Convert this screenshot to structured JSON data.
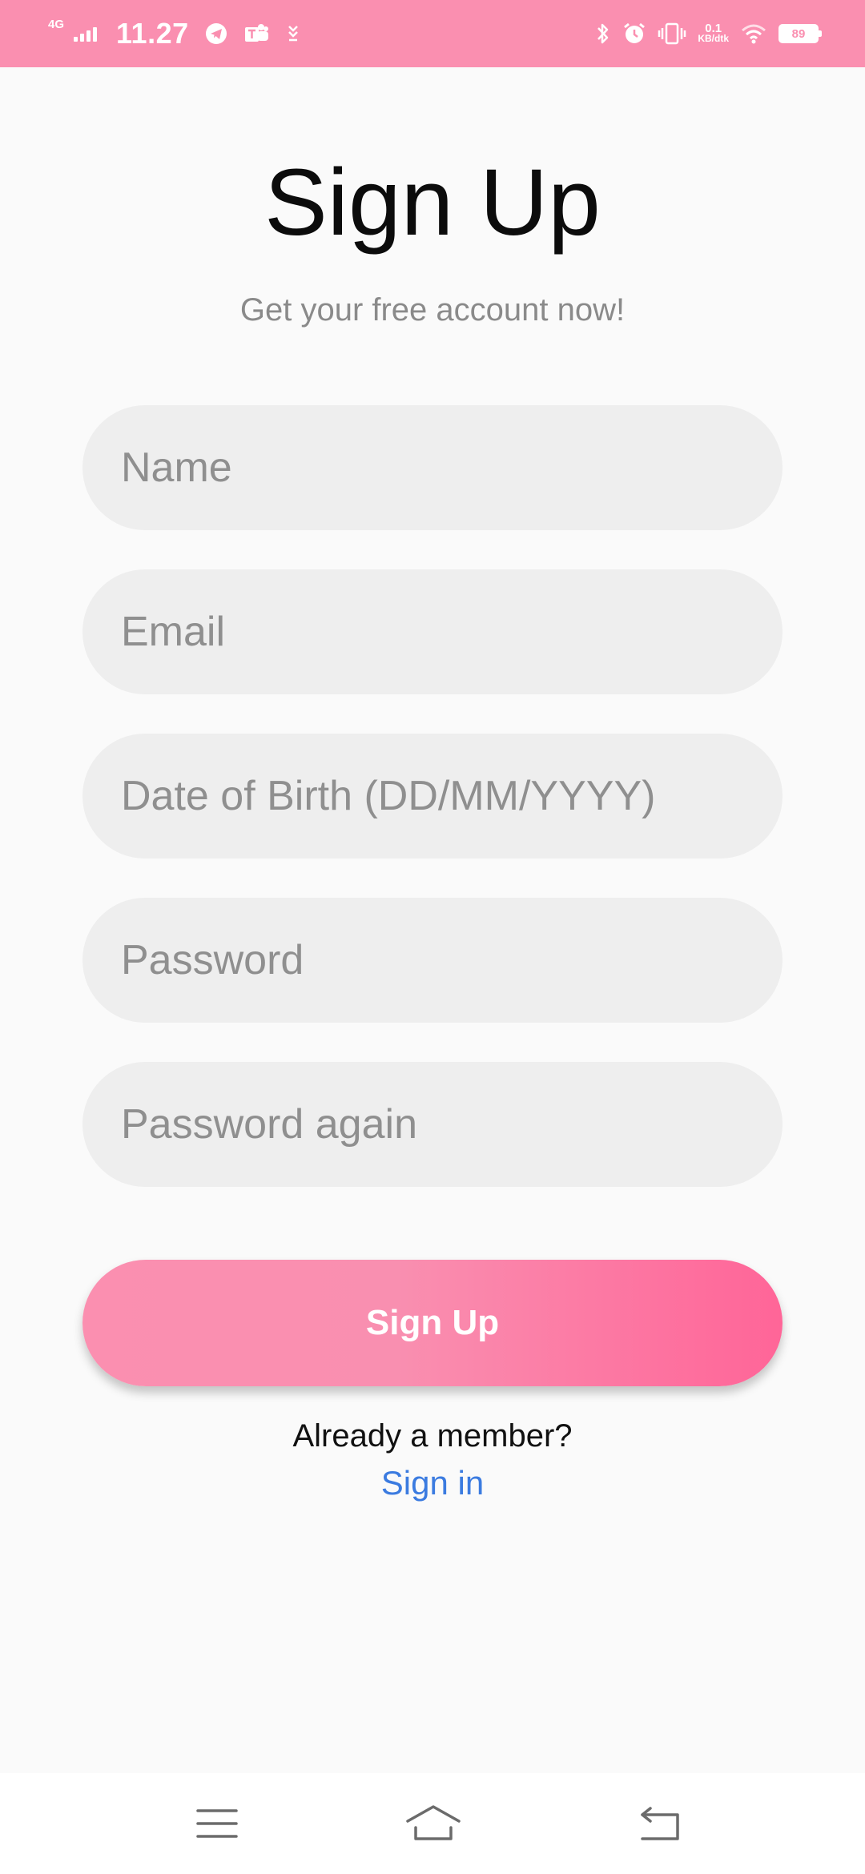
{
  "status_bar": {
    "network_type": "4G",
    "time": "11.27",
    "net_speed_value": "0.1",
    "net_speed_unit": "KB/dtk",
    "battery_level": "89",
    "background_color": "#fa8fb0",
    "left_icons": [
      "telegram-icon",
      "teams-icon",
      "download-icon"
    ],
    "right_icons": [
      "bluetooth-icon",
      "alarm-icon",
      "vibrate-icon",
      "wifi-icon",
      "battery-icon"
    ]
  },
  "header": {
    "title": "Sign Up",
    "subtitle": "Get your free account now!"
  },
  "form": {
    "name_placeholder": "Name",
    "email_placeholder": "Email",
    "dob_placeholder": "Date of Birth (DD/MM/YYYY)",
    "password_placeholder": "Password",
    "password_again_placeholder": "Password again",
    "submit_label": "Sign Up",
    "submit_gradient": [
      "#fb8fb0",
      "#ff6598"
    ]
  },
  "footer": {
    "member_text": "Already a member?",
    "signin_label": "Sign in",
    "link_color": "#3b7be0"
  },
  "nav_bar": {
    "icons": [
      "menu-icon",
      "home-icon",
      "back-icon"
    ]
  }
}
